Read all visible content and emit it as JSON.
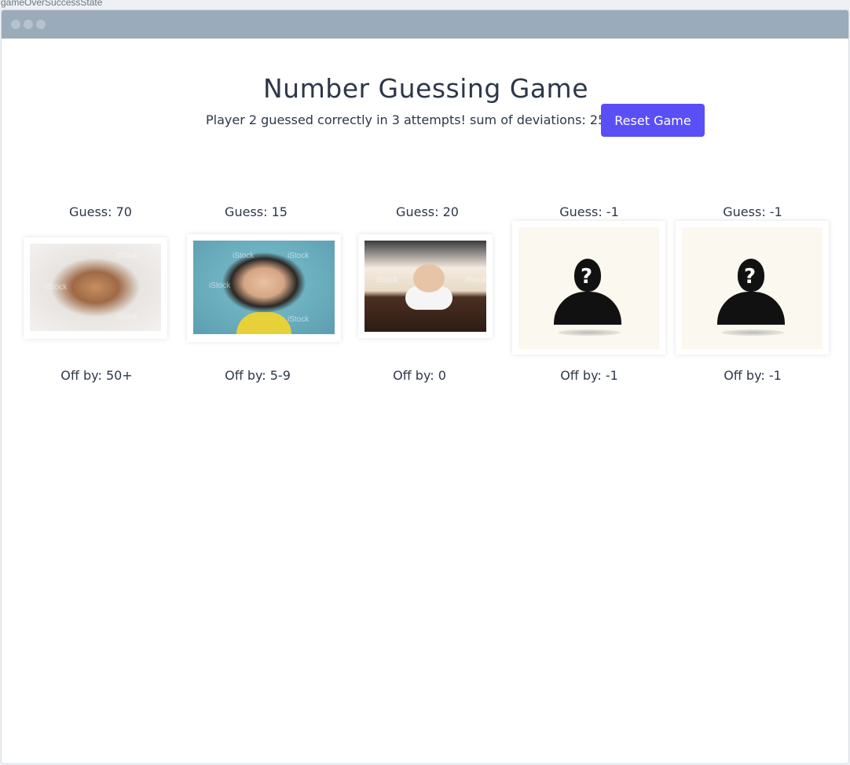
{
  "state_label": "gameOverSuccessState",
  "game": {
    "title": "Number Guessing Game",
    "status": "Player 2 guessed correctly in 3 attempts! sum of deviations: 25",
    "reset_label": "Reset Game"
  },
  "guesses": [
    {
      "guess": "Guess: 70",
      "off": "Off by: 50+",
      "image": "crying-baby-photo"
    },
    {
      "guess": "Guess: 15",
      "off": "Off by: 5-9",
      "image": "crying-toddler-photo"
    },
    {
      "guess": "Guess: 20",
      "off": "Off by: 0",
      "image": "laughing-baby-photo"
    },
    {
      "guess": "Guess: -1",
      "off": "Off by: -1",
      "image": "unknown-person-silhouette"
    },
    {
      "guess": "Guess: -1",
      "off": "Off by: -1",
      "image": "unknown-person-silhouette"
    }
  ],
  "watermark": "iStock",
  "colors": {
    "accent": "#5a4ff5",
    "titlebar": "#9aabb9",
    "text": "#2d3748"
  }
}
